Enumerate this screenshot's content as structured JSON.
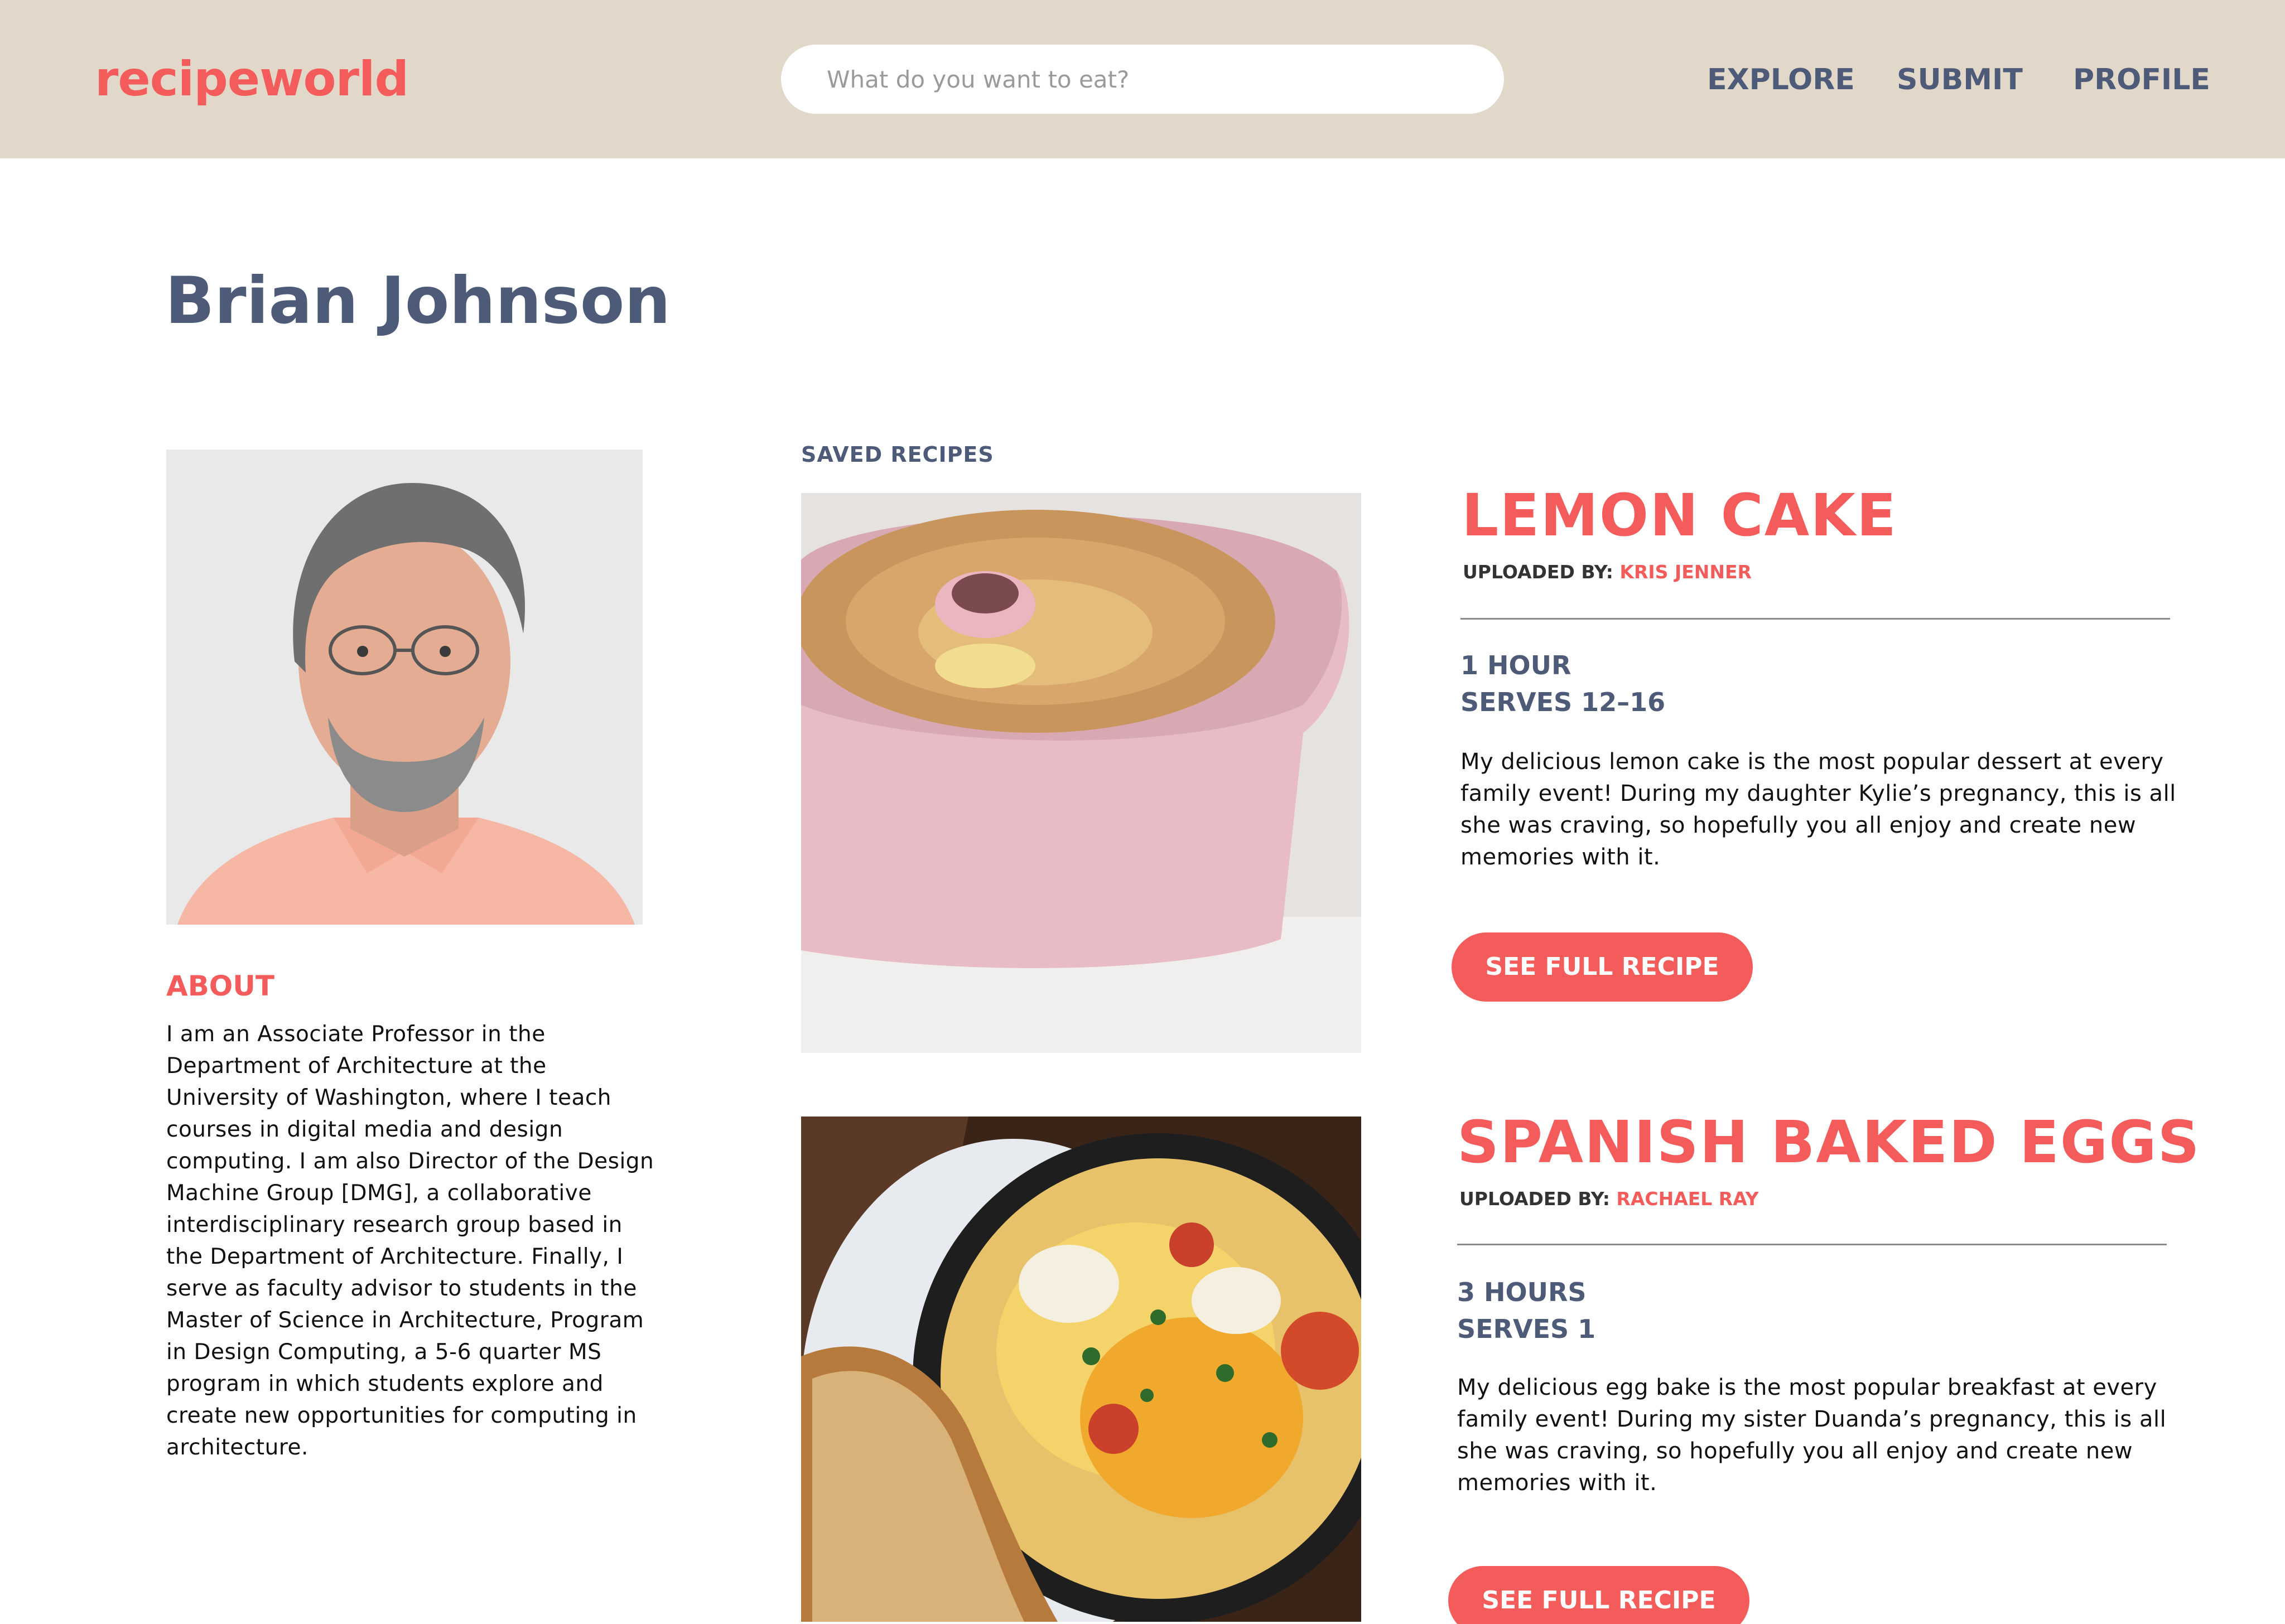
{
  "header": {
    "logo": "recipeworld",
    "search_placeholder": "What do you want to eat?",
    "nav": {
      "explore": "EXPLORE",
      "submit": "SUBMIT",
      "profile": "PROFILE"
    }
  },
  "profile": {
    "name": "Brian Johnson",
    "about_heading": "ABOUT",
    "about_text": "I am an Associate Professor in the Department of Architecture at the University of Washington, where I teach courses in digital media and design computing. I am also Director of the Design Machine Group [DMG], a collaborative interdisciplinary research group based in the Department of Architecture. Finally, I serve as faculty advisor to students in the Master of Science in Architecture, Program in Design Computing, a 5-6 quarter MS program in which students explore and create new opportunities for computing in architecture."
  },
  "saved": {
    "label": "SAVED RECIPES",
    "recipes": [
      {
        "title": "LEMON CAKE",
        "uploaded_label": "UPLOADED BY: ",
        "uploaded_by": "KRIS JENNER",
        "time": "1 HOUR",
        "serves": "SERVES 12–16",
        "description": "My delicious lemon cake is the most popular dessert at every family event! During my daughter Kylie’s pregnancy, this is all she was craving, so hopefully you all enjoy and create new memories with it.",
        "button": "SEE FULL RECIPE"
      },
      {
        "title": "SPANISH BAKED EGGS",
        "uploaded_label": "UPLOADED BY: ",
        "uploaded_by": "RACHAEL RAY",
        "time": "3 HOURS",
        "serves": "SERVES 1",
        "description": "My delicious egg bake is the most popular breakfast at every family event! During my sister Duanda’s pregnancy, this is all she was craving, so hopefully you all enjoy and create new memories with it.",
        "button": "SEE FULL RECIPE"
      }
    ]
  },
  "colors": {
    "accent": "#f45b5b",
    "slate": "#4d5a78",
    "header_bg": "#e1d8ca"
  },
  "icons": {
    "avatar": "portrait-photo",
    "recipe_1": "lemon-cake-photo",
    "recipe_2": "baked-eggs-photo"
  }
}
